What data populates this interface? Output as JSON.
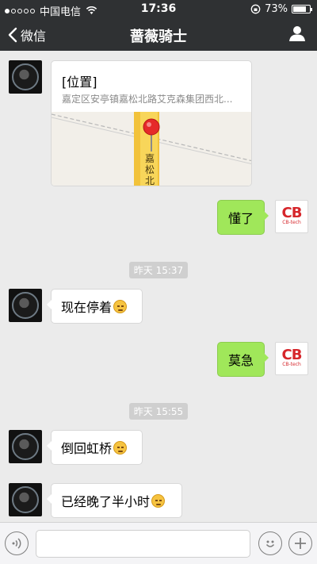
{
  "status_bar": {
    "carrier": "中国电信",
    "time": "17:36",
    "battery": "73%"
  },
  "nav": {
    "back_label": "微信",
    "title": "蔷薇骑士"
  },
  "messages": {
    "location": {
      "label": "[位置]",
      "address": "嘉定区安亭镇嘉松北路艾克森集团西北...",
      "map_road_label": "嘉松北路"
    },
    "sent1": "懂了",
    "timestamp1": "昨天 15:37",
    "recv1": "现在停着",
    "sent2": "莫急",
    "timestamp2": "昨天 15:55",
    "recv2": "倒回虹桥",
    "recv3": "已经晚了半小时"
  },
  "avatars": {
    "self_logo_main": "CB",
    "self_logo_sub": "CB-tech"
  },
  "colors": {
    "nav_bg": "#2f3133",
    "bubble_sent": "#a0e75a",
    "bubble_recv": "#ffffff",
    "chat_bg": "#ebebeb"
  }
}
